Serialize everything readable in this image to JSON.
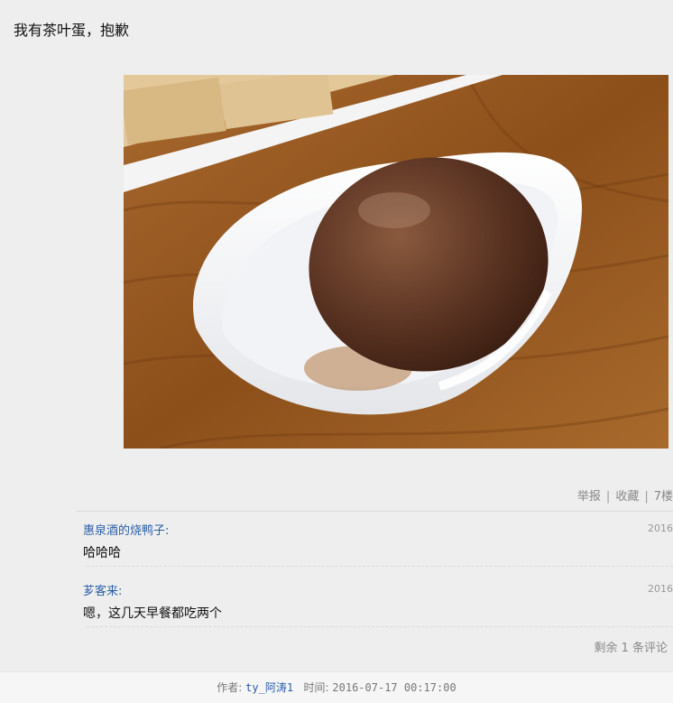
{
  "post": {
    "text": "我有茶叶蛋，抱歉",
    "image_alt": "tea egg in white dish"
  },
  "actions": {
    "report": "举报",
    "separator": "|",
    "favorite": "收藏",
    "floor": "7楼"
  },
  "comments": [
    {
      "user": "惠泉酒的烧鸭子:",
      "body": "哈哈哈",
      "date": "2016"
    },
    {
      "user": "芗客来:",
      "body": "嗯，这几天早餐都吃两个",
      "date": "2016"
    }
  ],
  "remaining": "剩余 1 条评论",
  "footer": {
    "author_label": "作者:",
    "author": "ty_阿涛1",
    "time_label": "时间:",
    "time": "2016-07-17 00:17:00"
  },
  "colors": {
    "background": "#eeeeee",
    "link": "#2a5ea8",
    "muted": "#888888"
  }
}
